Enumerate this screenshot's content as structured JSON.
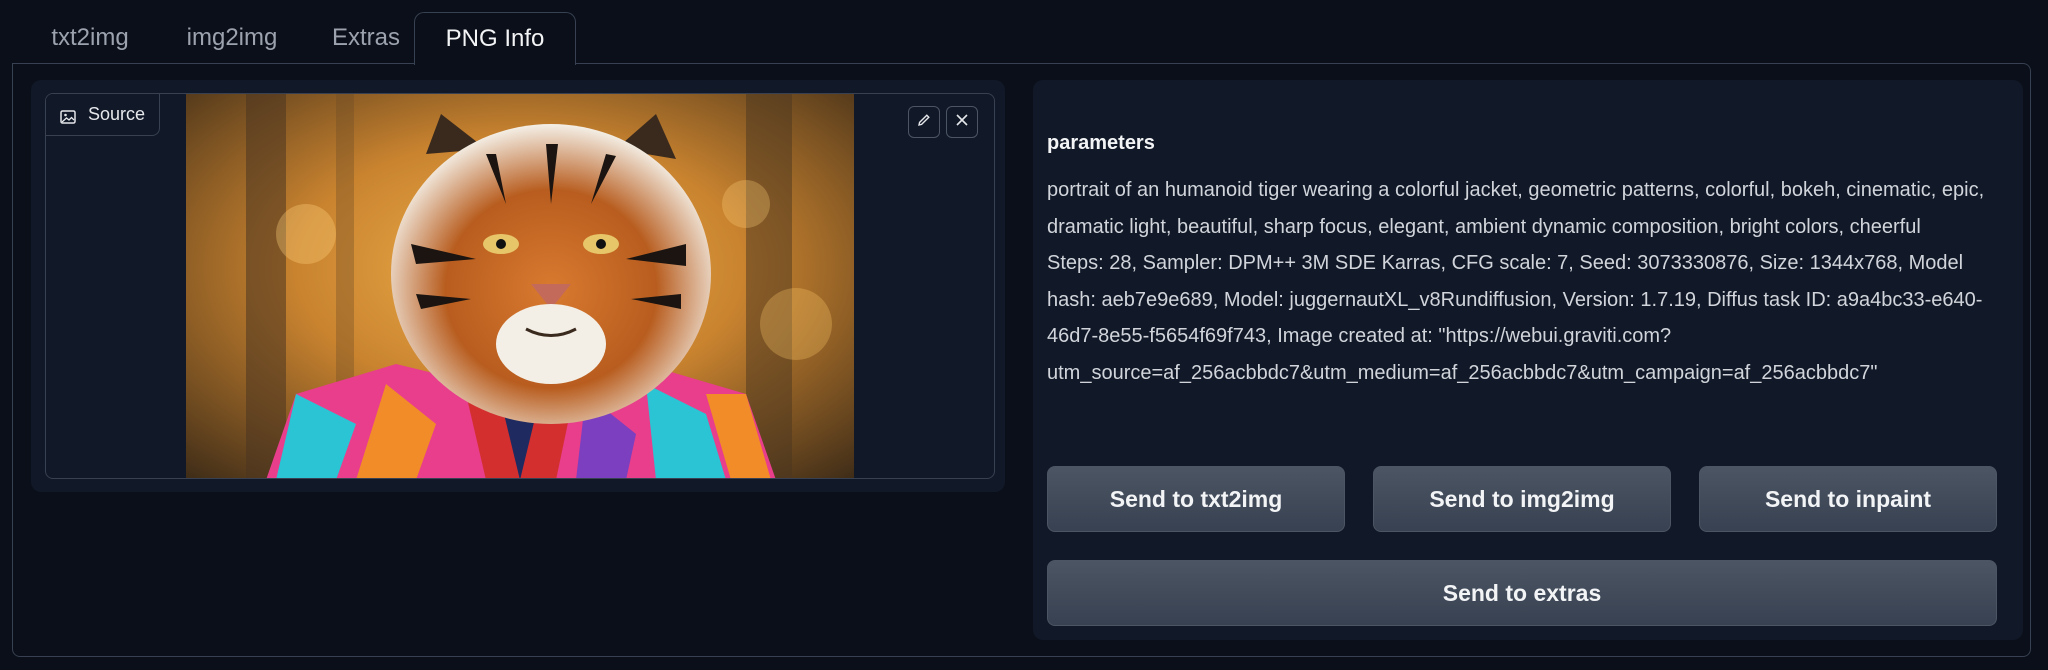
{
  "tabs": [
    {
      "label": "txt2img"
    },
    {
      "label": "img2img"
    },
    {
      "label": "Extras"
    },
    {
      "label": "PNG Info",
      "active": true
    }
  ],
  "image_panel": {
    "source_label": "Source",
    "icons": [
      "image-icon",
      "pencil-icon",
      "close-icon"
    ]
  },
  "parameters": {
    "title": "parameters",
    "prompt": "portrait of an humanoid tiger wearing a colorful jacket, geometric patterns, colorful, bokeh, cinematic, epic, dramatic light, beautiful, sharp focus, elegant, ambient dynamic composition, bright colors, cheerful",
    "settings": "Steps: 28, Sampler: DPM++ 3M SDE Karras, CFG scale: 7, Seed: 3073330876, Size: 1344x768, Model hash: aeb7e9e689, Model: juggernautXL_v8Rundiffusion, Version: 1.7.19, Diffus task ID: a9a4bc33-e640-46d7-8e55-f5654f69f743, Image created at: \"https://webui.graviti.com?utm_source=af_256acbbdc7&utm_medium=af_256acbbdc7&utm_campaign=af_256acbbdc7\""
  },
  "actions": {
    "send_txt2img": "Send to txt2img",
    "send_img2img": "Send to img2img",
    "send_inpaint": "Send to inpaint",
    "send_extras": "Send to extras"
  },
  "colors": {
    "background": "#0b0f19",
    "card": "#111827",
    "border": "#374151",
    "button": "#4b5563"
  }
}
